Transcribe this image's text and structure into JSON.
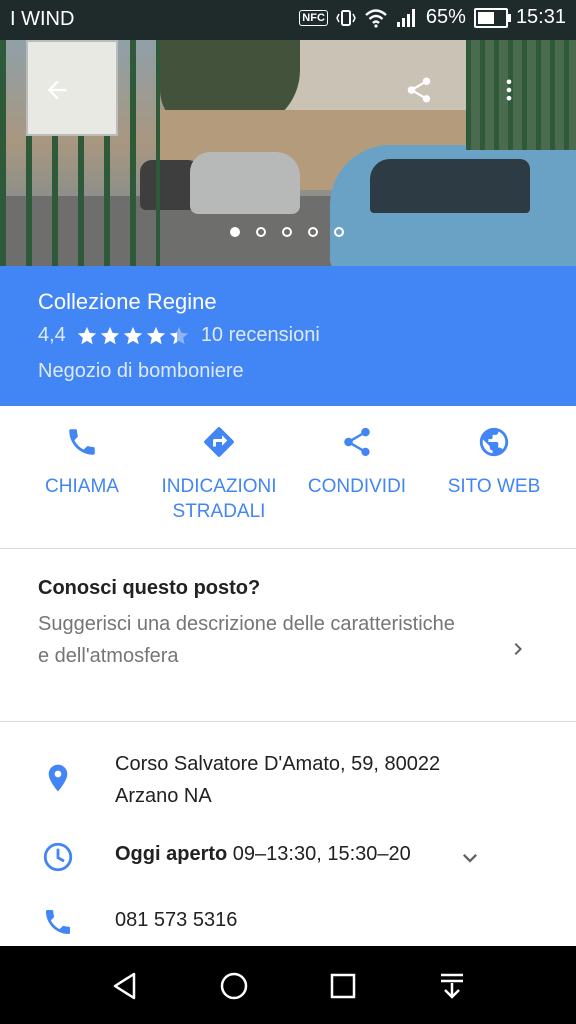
{
  "status_bar": {
    "carrier": "I WIND",
    "nfc": "NFC",
    "battery_percent": "65%",
    "battery_level": 0.65,
    "time": "15:31"
  },
  "place": {
    "name": "Collezione Regine",
    "rating": "4,4",
    "stars": 4.4,
    "reviews": "10 recensioni",
    "category": "Negozio di bomboniere"
  },
  "photos": {
    "count": 5,
    "active_index": 0
  },
  "actions": [
    {
      "label": "CHIAMA",
      "icon": "phone-icon"
    },
    {
      "label": "INDICAZIONI STRADALI",
      "icon": "directions-icon"
    },
    {
      "label": "CONDIVIDI",
      "icon": "share-icon"
    },
    {
      "label": "SITO WEB",
      "icon": "globe-icon"
    }
  ],
  "suggest": {
    "title": "Conosci questo posto?",
    "description": "Suggerisci una descrizione delle caratteristiche e dell'atmosfera"
  },
  "details": {
    "address": "Corso Salvatore D'Amato, 59, 80022 Arzano NA",
    "hours_label": "Oggi aperto",
    "hours_value": "09–13:30, 15:30–20",
    "phone": "081 573 5316"
  },
  "colors": {
    "accent": "#4285f4",
    "status_bar": "#1f2a2a",
    "nav_bar": "#000000"
  }
}
